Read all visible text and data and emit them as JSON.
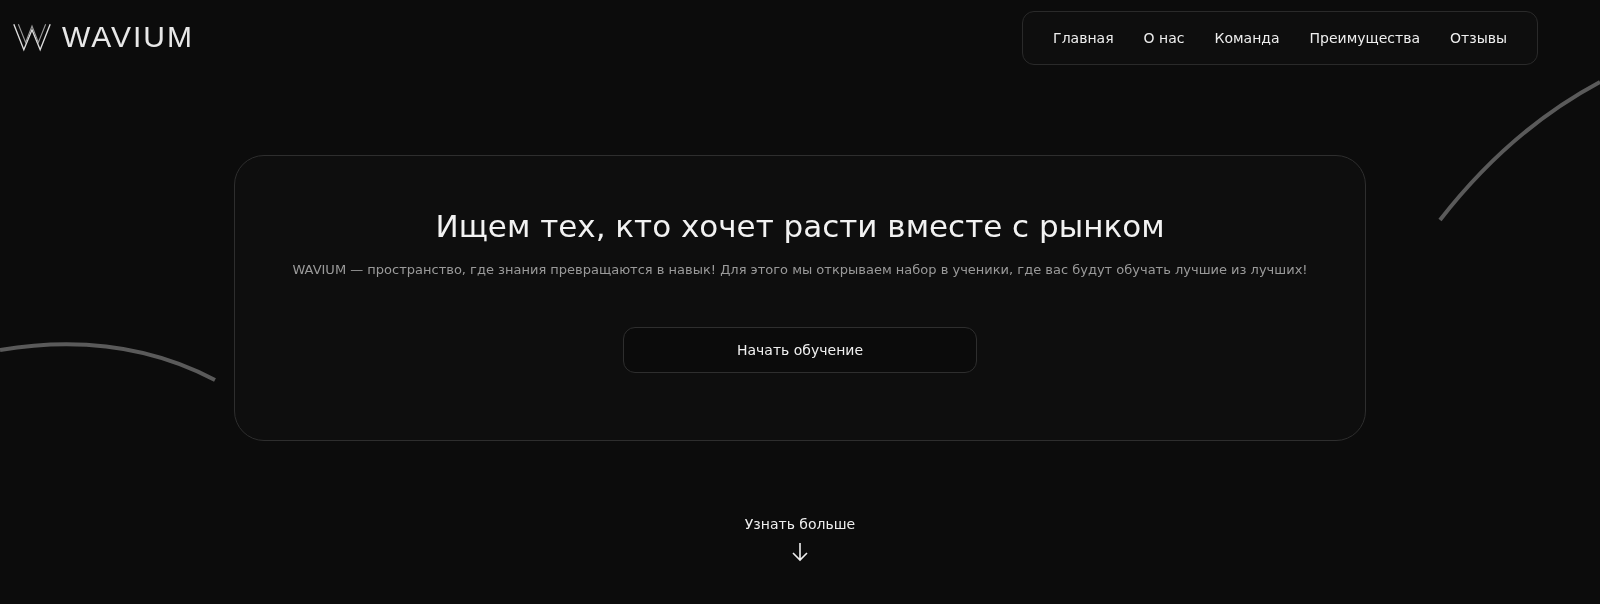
{
  "header": {
    "logo_text": "WAVIUM",
    "nav": [
      {
        "label": "Главная"
      },
      {
        "label": "О нас"
      },
      {
        "label": "Команда"
      },
      {
        "label": "Преимущества"
      },
      {
        "label": "Отзывы"
      }
    ]
  },
  "hero": {
    "title": "Ищем тех, кто хочет расти вместе с рынком",
    "subtitle": "WAVIUM — пространство, где знания превращаются в навык! Для этого мы открываем набор в ученики, где вас будут обучать лучшие из лучших!",
    "button": "Начать обучение"
  },
  "more": {
    "label": "Узнать больше"
  }
}
